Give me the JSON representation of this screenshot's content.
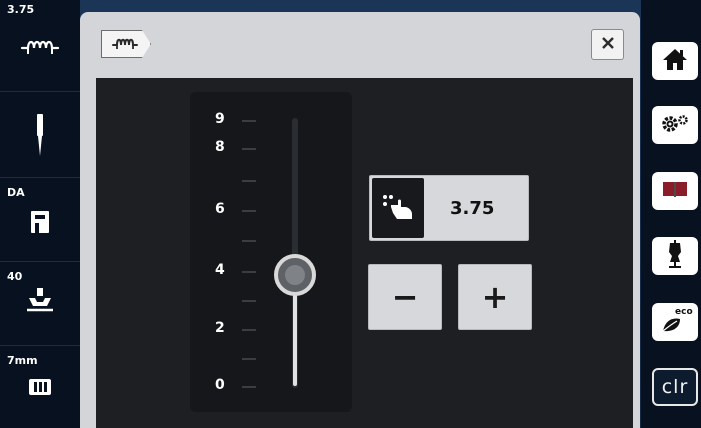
{
  "sidebar_left": {
    "stitch_length": {
      "value": "3.75",
      "icon": "stitch-length-icon"
    },
    "needle": {
      "icon": "needle-icon"
    },
    "foot_indicator": {
      "label": "DA",
      "icon": "presser-foot-letter-icon"
    },
    "presser_foot": {
      "label": "40",
      "icon": "presser-foot-pressure-icon"
    },
    "stitch_plate": {
      "label": "7mm",
      "icon": "stitch-plate-icon"
    }
  },
  "sidebar_right": {
    "buttons": [
      {
        "icon": "home-icon"
      },
      {
        "icon": "settings-icon"
      },
      {
        "icon": "guide-book-icon"
      },
      {
        "icon": "sewing-consultant-icon"
      },
      {
        "icon": "eco-icon",
        "label": "eco"
      },
      {
        "icon": "clear-icon",
        "label": "clr"
      }
    ]
  },
  "panel": {
    "tab_icon": "stitch-length-icon",
    "close_icon": "close-icon"
  },
  "slider": {
    "labels": [
      "9",
      "8",
      "6",
      "4",
      "2",
      "0"
    ],
    "min": 0,
    "max": 9,
    "value": 3.75
  },
  "value_field": {
    "icon": "touch-hand-icon",
    "value": "3.75"
  },
  "stepper": {
    "minus_label": "−",
    "plus_label": "+"
  }
}
